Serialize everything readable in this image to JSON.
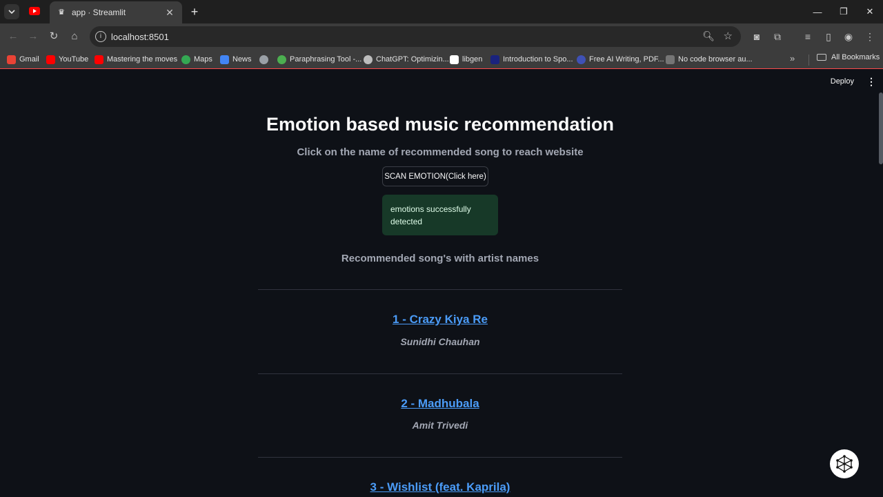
{
  "browser": {
    "tab_title": "app · Streamlit",
    "url": "localhost:8501",
    "bookmarks": [
      {
        "label": "Gmail",
        "color": "#ea4335"
      },
      {
        "label": "YouTube",
        "color": "#ff0000"
      },
      {
        "label": "Mastering the moves",
        "color": "#ff0000"
      },
      {
        "label": "Maps",
        "color": "#34a853"
      },
      {
        "label": "News",
        "color": "#4285f4"
      },
      {
        "label": "",
        "color": "#9aa0a6"
      },
      {
        "label": "Paraphrasing Tool -...",
        "color": "#4caf50"
      },
      {
        "label": "ChatGPT: Optimizin...",
        "color": "#bdbdbd"
      },
      {
        "label": "libgen",
        "color": "#ffffff"
      },
      {
        "label": "Introduction to Spo...",
        "color": "#1a237e"
      },
      {
        "label": "Free AI Writing, PDF...",
        "color": "#3f51b5"
      },
      {
        "label": "No code browser au...",
        "color": "#757575"
      }
    ],
    "all_bookmarks_label": "All Bookmarks"
  },
  "app": {
    "deploy_label": "Deploy",
    "title": "Emotion based music recommendation",
    "subtitle": "Click on the name of recommended song to reach website",
    "scan_button_label": "SCAN EMOTION(Click here)",
    "success_message": "emotions successfully detected",
    "recommend_header": "Recommended song's with artist names",
    "songs": [
      {
        "title": "1 - Crazy Kiya Re",
        "artist": "Sunidhi Chauhan"
      },
      {
        "title": "2 - Madhubala",
        "artist": "Amit Trivedi"
      },
      {
        "title": "3 - Wishlist (feat. Kaprila)",
        "artist": ""
      }
    ]
  },
  "colors": {
    "background": "#0e1117",
    "link": "#4b9cf8",
    "success_bg": "#173928",
    "accent_line": "#ff4b4b"
  }
}
